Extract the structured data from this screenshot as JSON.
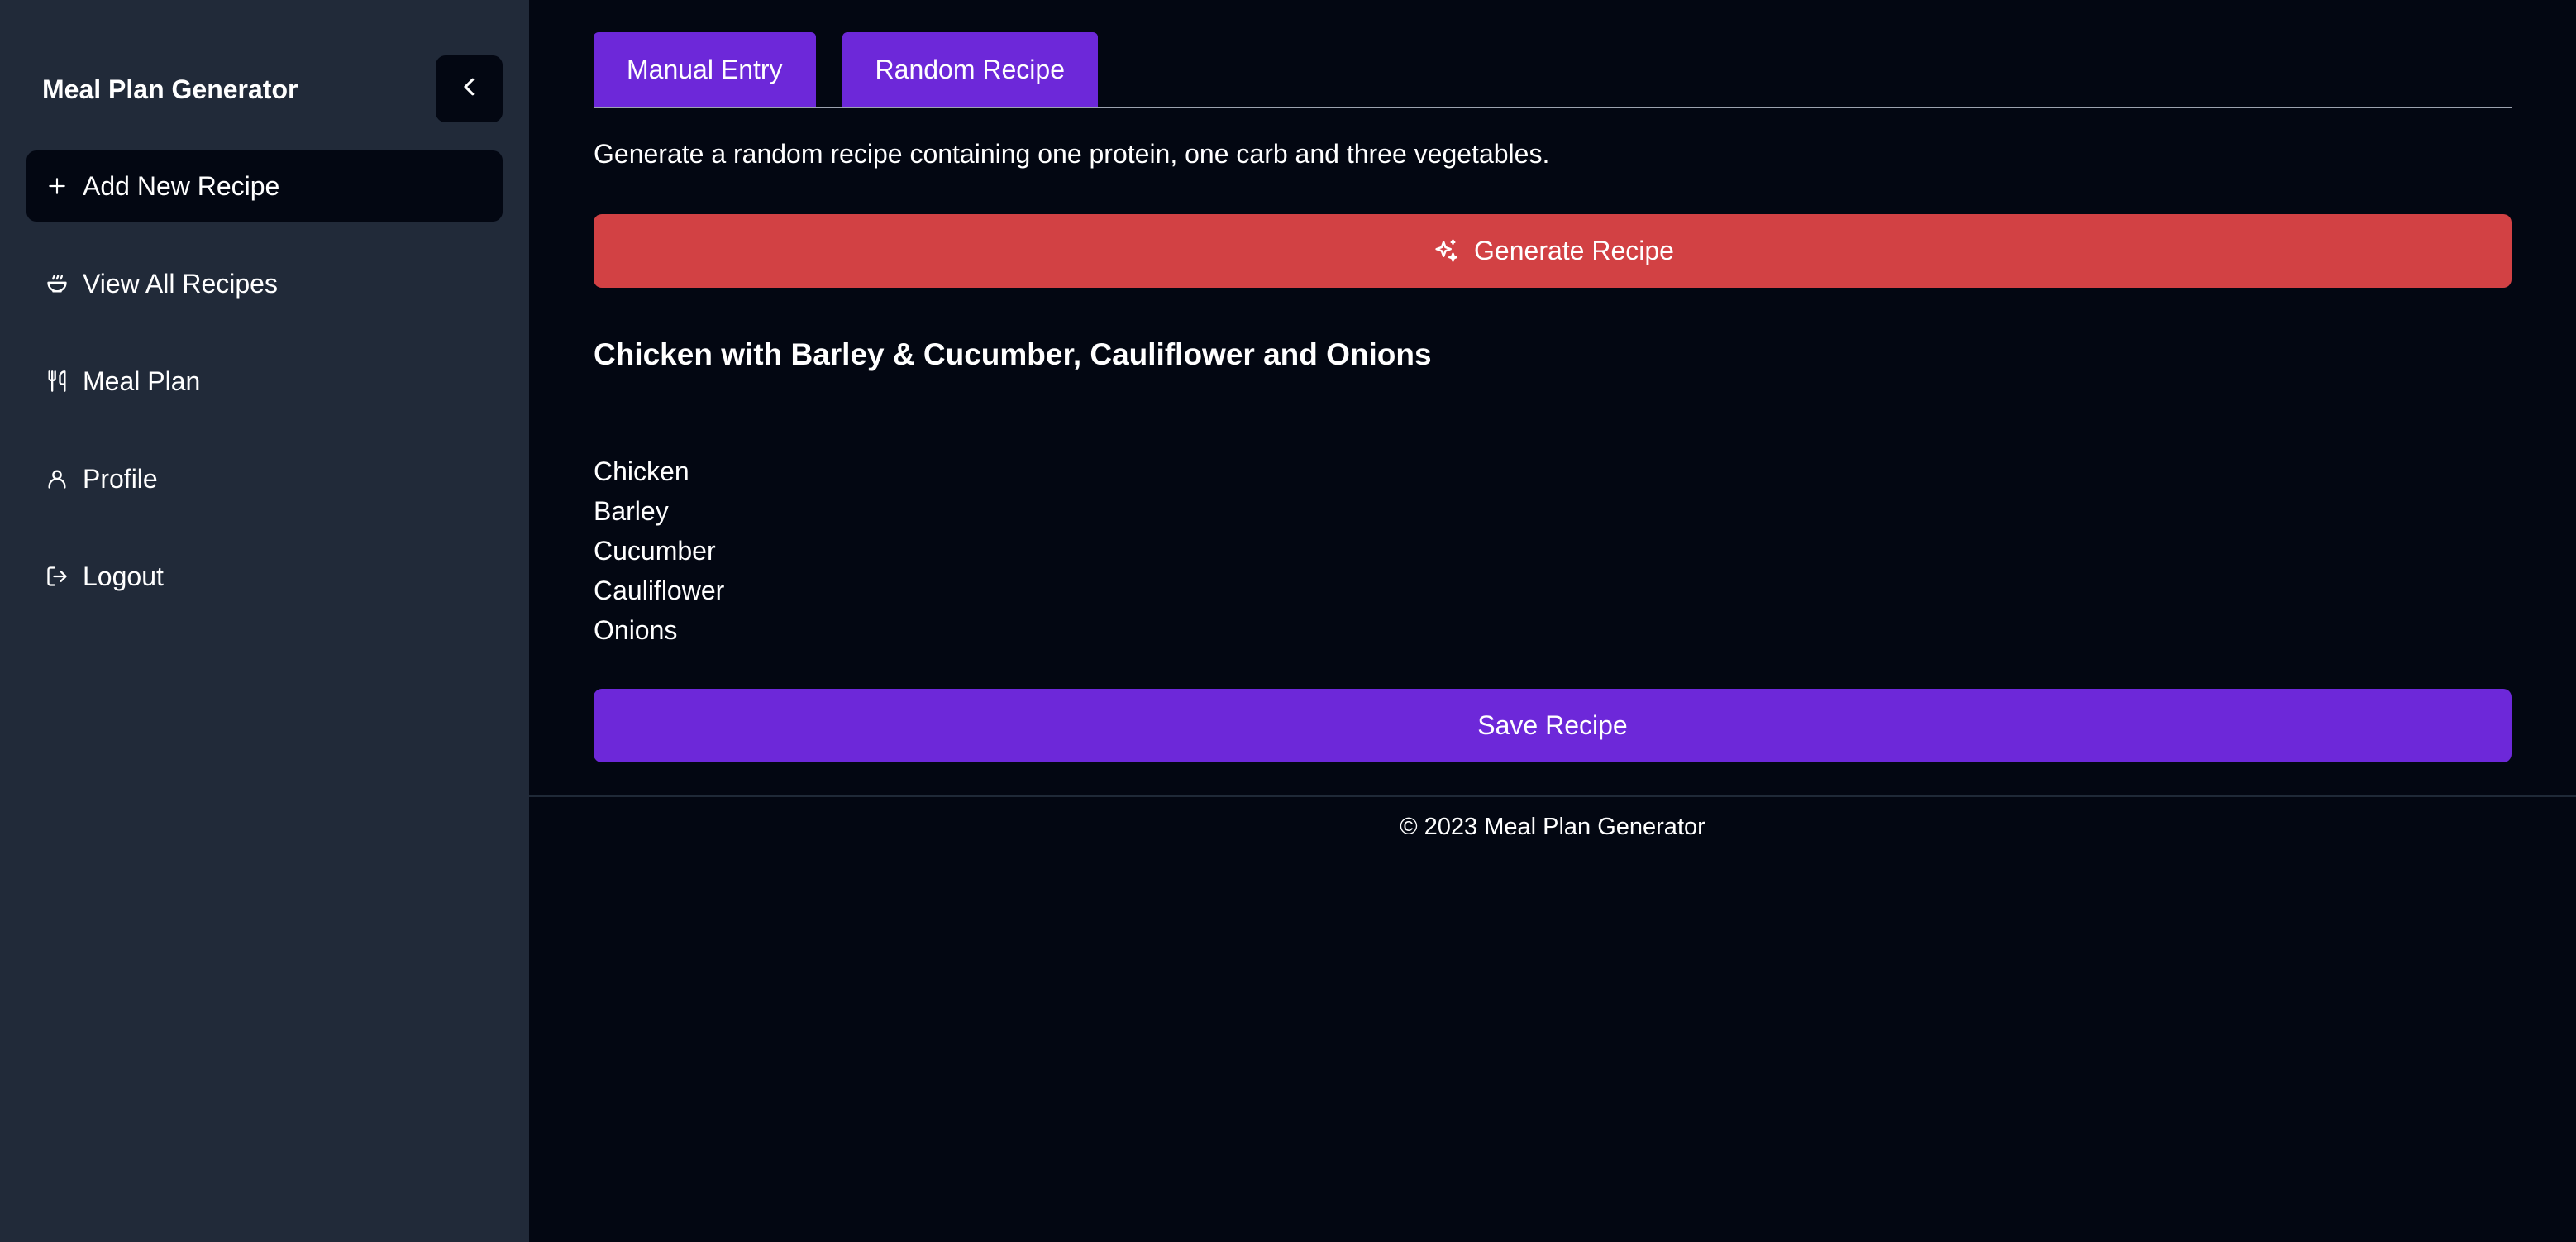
{
  "sidebar": {
    "title": "Meal Plan Generator",
    "items": [
      {
        "label": "Add New Recipe",
        "icon": "plus-icon",
        "active": true
      },
      {
        "label": "View All Recipes",
        "icon": "bowl-icon",
        "active": false
      },
      {
        "label": "Meal Plan",
        "icon": "utensils-icon",
        "active": false
      },
      {
        "label": "Profile",
        "icon": "user-icon",
        "active": false
      },
      {
        "label": "Logout",
        "icon": "logout-icon",
        "active": false
      }
    ]
  },
  "tabs": [
    {
      "label": "Manual Entry"
    },
    {
      "label": "Random Recipe"
    }
  ],
  "main": {
    "description": "Generate a random recipe containing one protein, one carb and three vegetables.",
    "generate_label": "Generate Recipe",
    "recipe_title": "Chicken with Barley & Cucumber, Cauliflower and Onions",
    "ingredients": [
      "Chicken",
      "Barley",
      "Cucumber",
      "Cauliflower",
      "Onions"
    ],
    "save_label": "Save Recipe"
  },
  "footer": {
    "text": "© 2023 Meal Plan Generator"
  },
  "colors": {
    "sidebar_bg": "#212a39",
    "main_bg": "#030712",
    "accent_purple": "#6d28d9",
    "generate_red": "#d24144"
  }
}
